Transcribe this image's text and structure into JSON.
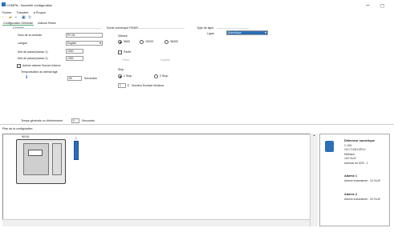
{
  "window": {
    "title": "COMPA - Nouvelle configuration",
    "minimize": "–",
    "maximize": "◻"
  },
  "menu": [
    "Fichier",
    "Transfert",
    "A Propos"
  ],
  "tabs": [
    "Configuration Générale",
    "Actions Robot"
  ],
  "controle": {
    "heading": "Centrale",
    "nom_label": "Nom de la centrale",
    "nom_value": "PH 34",
    "langue_label": "Langue",
    "langue_value": "English",
    "mdp1_label": "Mot de passe(niveau 1)",
    "mdp1_value": "1000",
    "mdp2_label": "Mot de passe(niveau 2)",
    "mdp2_value": "1000",
    "alarme_label": "Activer alarme Sonore interne",
    "alarme_checked": "✓",
    "tempo_label": "Temporisation au démarrage",
    "tempo_value": "60",
    "tempo_unit": "Secondes",
    "tempo_general_label": "Temps générale ou d'évènement",
    "tempo_general_value": "0",
    "tempo_general_unit": "Secondes"
  },
  "sortie": {
    "heading": "Sortie numérique RS485",
    "vitesse_label": "Vitesse",
    "speeds": [
      "9600",
      "19200",
      "38400"
    ],
    "parite_label": "Parité",
    "parite_opts": [
      "Paire",
      "Impaire"
    ],
    "stop_label": "Stop",
    "stop_opts": [
      "1 Stop",
      "2 Stop"
    ],
    "modbus_value": "1",
    "modbus_label": "Numéro Esclave Modbus"
  },
  "type_ligne": {
    "heading": "Type de ligne",
    "ligne_label": "Ligne",
    "ligne_value": "Numérique"
  },
  "plan": {
    "heading": "Plan de la configuration",
    "central_label": "MX16",
    "detector_label": "1"
  },
  "detail": {
    "title": "Détecteur numérique",
    "sub": "C-DIN",
    "line1": "OLCT10N-DIPLO",
    "line2": "Méthane",
    "line3": "100 %LIE",
    "line4": "Adresse de EEE : 1",
    "alarm1_title": "Alarme 1",
    "alarm1_text": "Alarme instantanée : 10 %LIE",
    "alarm2_title": "Alarme 2",
    "alarm2_text": "Alarme instantanée : 30 %LIE"
  },
  "colors": {
    "accent": "#2c6fb7",
    "tab_underline": "#5a7"
  }
}
